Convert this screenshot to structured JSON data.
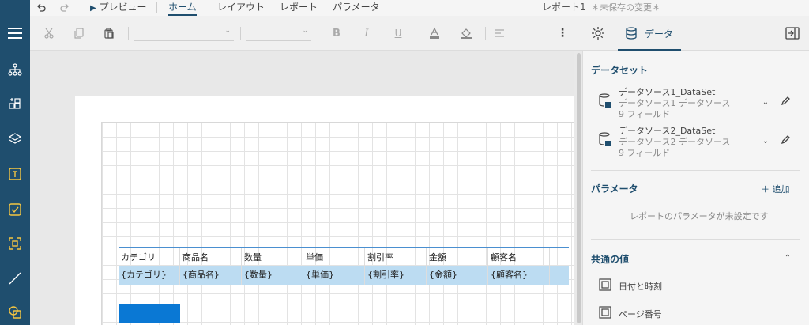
{
  "menubar": {
    "undo_label": "",
    "preview": "プレビュー",
    "tabs": [
      {
        "label": "ホーム",
        "active": true
      },
      {
        "label": "レイアウト",
        "active": false
      },
      {
        "label": "レポート",
        "active": false
      },
      {
        "label": "パラメータ",
        "active": false
      }
    ],
    "document_name": "レポート1",
    "unsaved": "＊未保存の変更＊"
  },
  "toolbar": {
    "data_tab": "データ"
  },
  "table": {
    "headers": [
      "カテゴリ",
      "商品名",
      "数量",
      "単価",
      "割引率",
      "金額",
      "顧客名"
    ],
    "details": [
      "{カテゴリ}",
      "{商品名}",
      "{数量}",
      "{単価}",
      "{割引率}",
      "{金額}",
      "{顧客名}"
    ]
  },
  "panel": {
    "datasets_title": "データセット",
    "datasets": [
      {
        "name": "データソース1_DataSet",
        "source": "データソース1 データソース",
        "fields": "9 フィールド"
      },
      {
        "name": "データソース2_DataSet",
        "source": "データソース2 データソース",
        "fields": "9 フィールド"
      }
    ],
    "params_title": "パラメータ",
    "add_label": "追加",
    "params_empty": "レポートのパラメータが未設定です",
    "common_title": "共通の値",
    "common_items": [
      "日付と時刻",
      "ページ番号"
    ]
  },
  "colors": {
    "sidebar": "#1f4e6e",
    "accent": "#0a78d4",
    "detail_row": "#bcdcf2"
  }
}
